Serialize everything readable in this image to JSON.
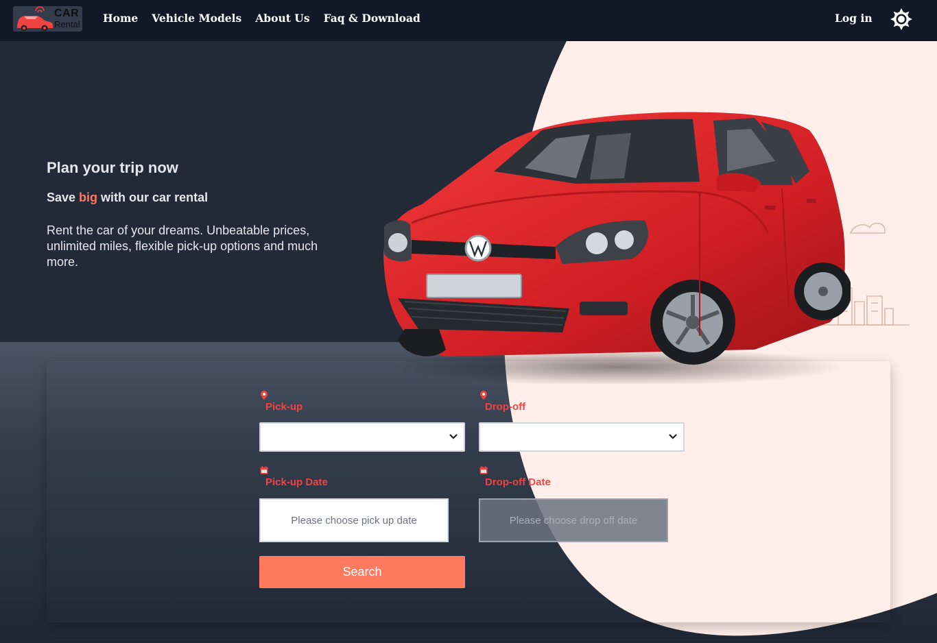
{
  "nav": {
    "logo": {
      "brand": "CAR",
      "sub": "Rental"
    },
    "links": [
      "Home",
      "Vehicle Models",
      "About Us",
      "Faq & Download"
    ],
    "login": "Log in",
    "theme_icon": "sun-icon"
  },
  "hero": {
    "title": "Plan your trip now",
    "subtitle_pre": "Save ",
    "subtitle_accent": "big",
    "subtitle_post": " with our car rental",
    "description": "Rent the car of your dreams. Unbeatable prices, unlimited miles, flexible pick-up options and much more."
  },
  "form": {
    "pickup_label": "Pick-up",
    "dropoff_label": "Drop-off",
    "pickup_date_label": "Pick-up Date",
    "dropoff_date_label": "Drop-off Date",
    "pickup_date_placeholder": "Please choose pick up date",
    "dropoff_date_placeholder": "Please choose drop off date",
    "search_label": "Search"
  },
  "colors": {
    "navbar": "#111827",
    "hero_bg": "#222a38",
    "accent": "#ff7a5e",
    "label_red": "#ef4444",
    "pink_shape": "#ffeee9"
  }
}
